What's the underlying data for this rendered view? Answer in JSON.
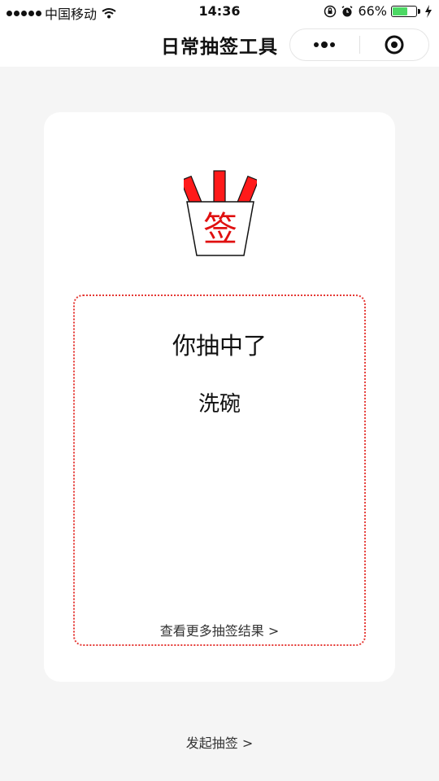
{
  "status_bar": {
    "carrier": "中国移动",
    "time": "14:36",
    "battery_percent": "66%",
    "battery_level": 0.66,
    "icons": [
      "signal-dots-icon",
      "wifi-icon",
      "orientation-lock-icon",
      "alarm-icon",
      "battery-icon",
      "charging-bolt-icon"
    ]
  },
  "nav": {
    "title": "日常抽签工具",
    "menu_icon": "more-dots-icon",
    "close_icon": "target-circle-icon"
  },
  "card": {
    "lots_icon_char": "签",
    "result_heading": "你抽中了",
    "result_value": "洗碗",
    "more_results_link": "查看更多抽签结果 >"
  },
  "footer": {
    "start_link": "发起抽签 >"
  },
  "colors": {
    "accent_red": "#e53935",
    "battery_green": "#4cd964",
    "background": "#f5f5f5"
  }
}
